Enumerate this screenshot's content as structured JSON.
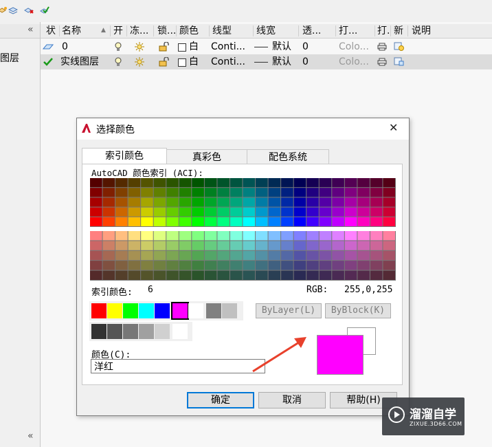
{
  "toolbar": {
    "icons": [
      "new-layer-icon",
      "layer-states-icon",
      "delete-layer-icon",
      "set-current-icon"
    ]
  },
  "left_panel": {
    "collapse_glyph": "«",
    "item_label": "图层",
    "bottom_glyph": "«"
  },
  "layer_table": {
    "columns": [
      "状",
      "名称",
      "开",
      "冻...",
      "锁...",
      "颜色",
      "线型",
      "线宽",
      "透...",
      "打...",
      "打.",
      "新",
      "说明"
    ],
    "sort_glyph": "▲",
    "rows": [
      {
        "name": "0",
        "color": "白",
        "linetype": "Conti...",
        "lineweight": "默认",
        "transparency": "0",
        "plot_style": "Colo...",
        "selected": false
      },
      {
        "name": "实线图层",
        "color": "白",
        "linetype": "Conti...",
        "lineweight": "默认",
        "transparency": "0",
        "plot_style": "Colo...",
        "selected": true
      }
    ]
  },
  "dialog": {
    "title": "选择颜色",
    "close_glyph": "✕",
    "tabs": [
      "索引颜色",
      "真彩色",
      "配色系统"
    ],
    "aci_label": "AutoCAD 颜色索引 (ACI):",
    "index_label": "索引颜色:",
    "index_value": "6",
    "rgb_label": "RGB:",
    "rgb_value": "255,0,255",
    "standard_colors": [
      "#ff0000",
      "#ffff00",
      "#00ff00",
      "#00ffff",
      "#0000ff",
      "#ff00ff",
      "#ffffff",
      "#808080",
      "#c0c0c0"
    ],
    "gray_colors": [
      "#333333",
      "#555555",
      "#777777",
      "#a0a0a0",
      "#d0d0d0",
      "#ffffff"
    ],
    "selected_standard_index": 5,
    "bylayer_label": "ByLayer(L)",
    "byblock_label": "ByBlock(K)",
    "color_label": "颜色(C):",
    "color_input_value": "洋红",
    "preview_new_color": "#ff00ff",
    "preview_old_color": "#ffffff",
    "ok_label": "确定",
    "cancel_label": "取消",
    "help_label": "帮助(H)"
  },
  "watermark": {
    "brand": "溜溜自学",
    "url": "ZIXUE.3D66.COM"
  },
  "colors": {
    "accent": "#0078d7",
    "arrow": "#e8412c",
    "selected_row": "#dcdcdc"
  }
}
